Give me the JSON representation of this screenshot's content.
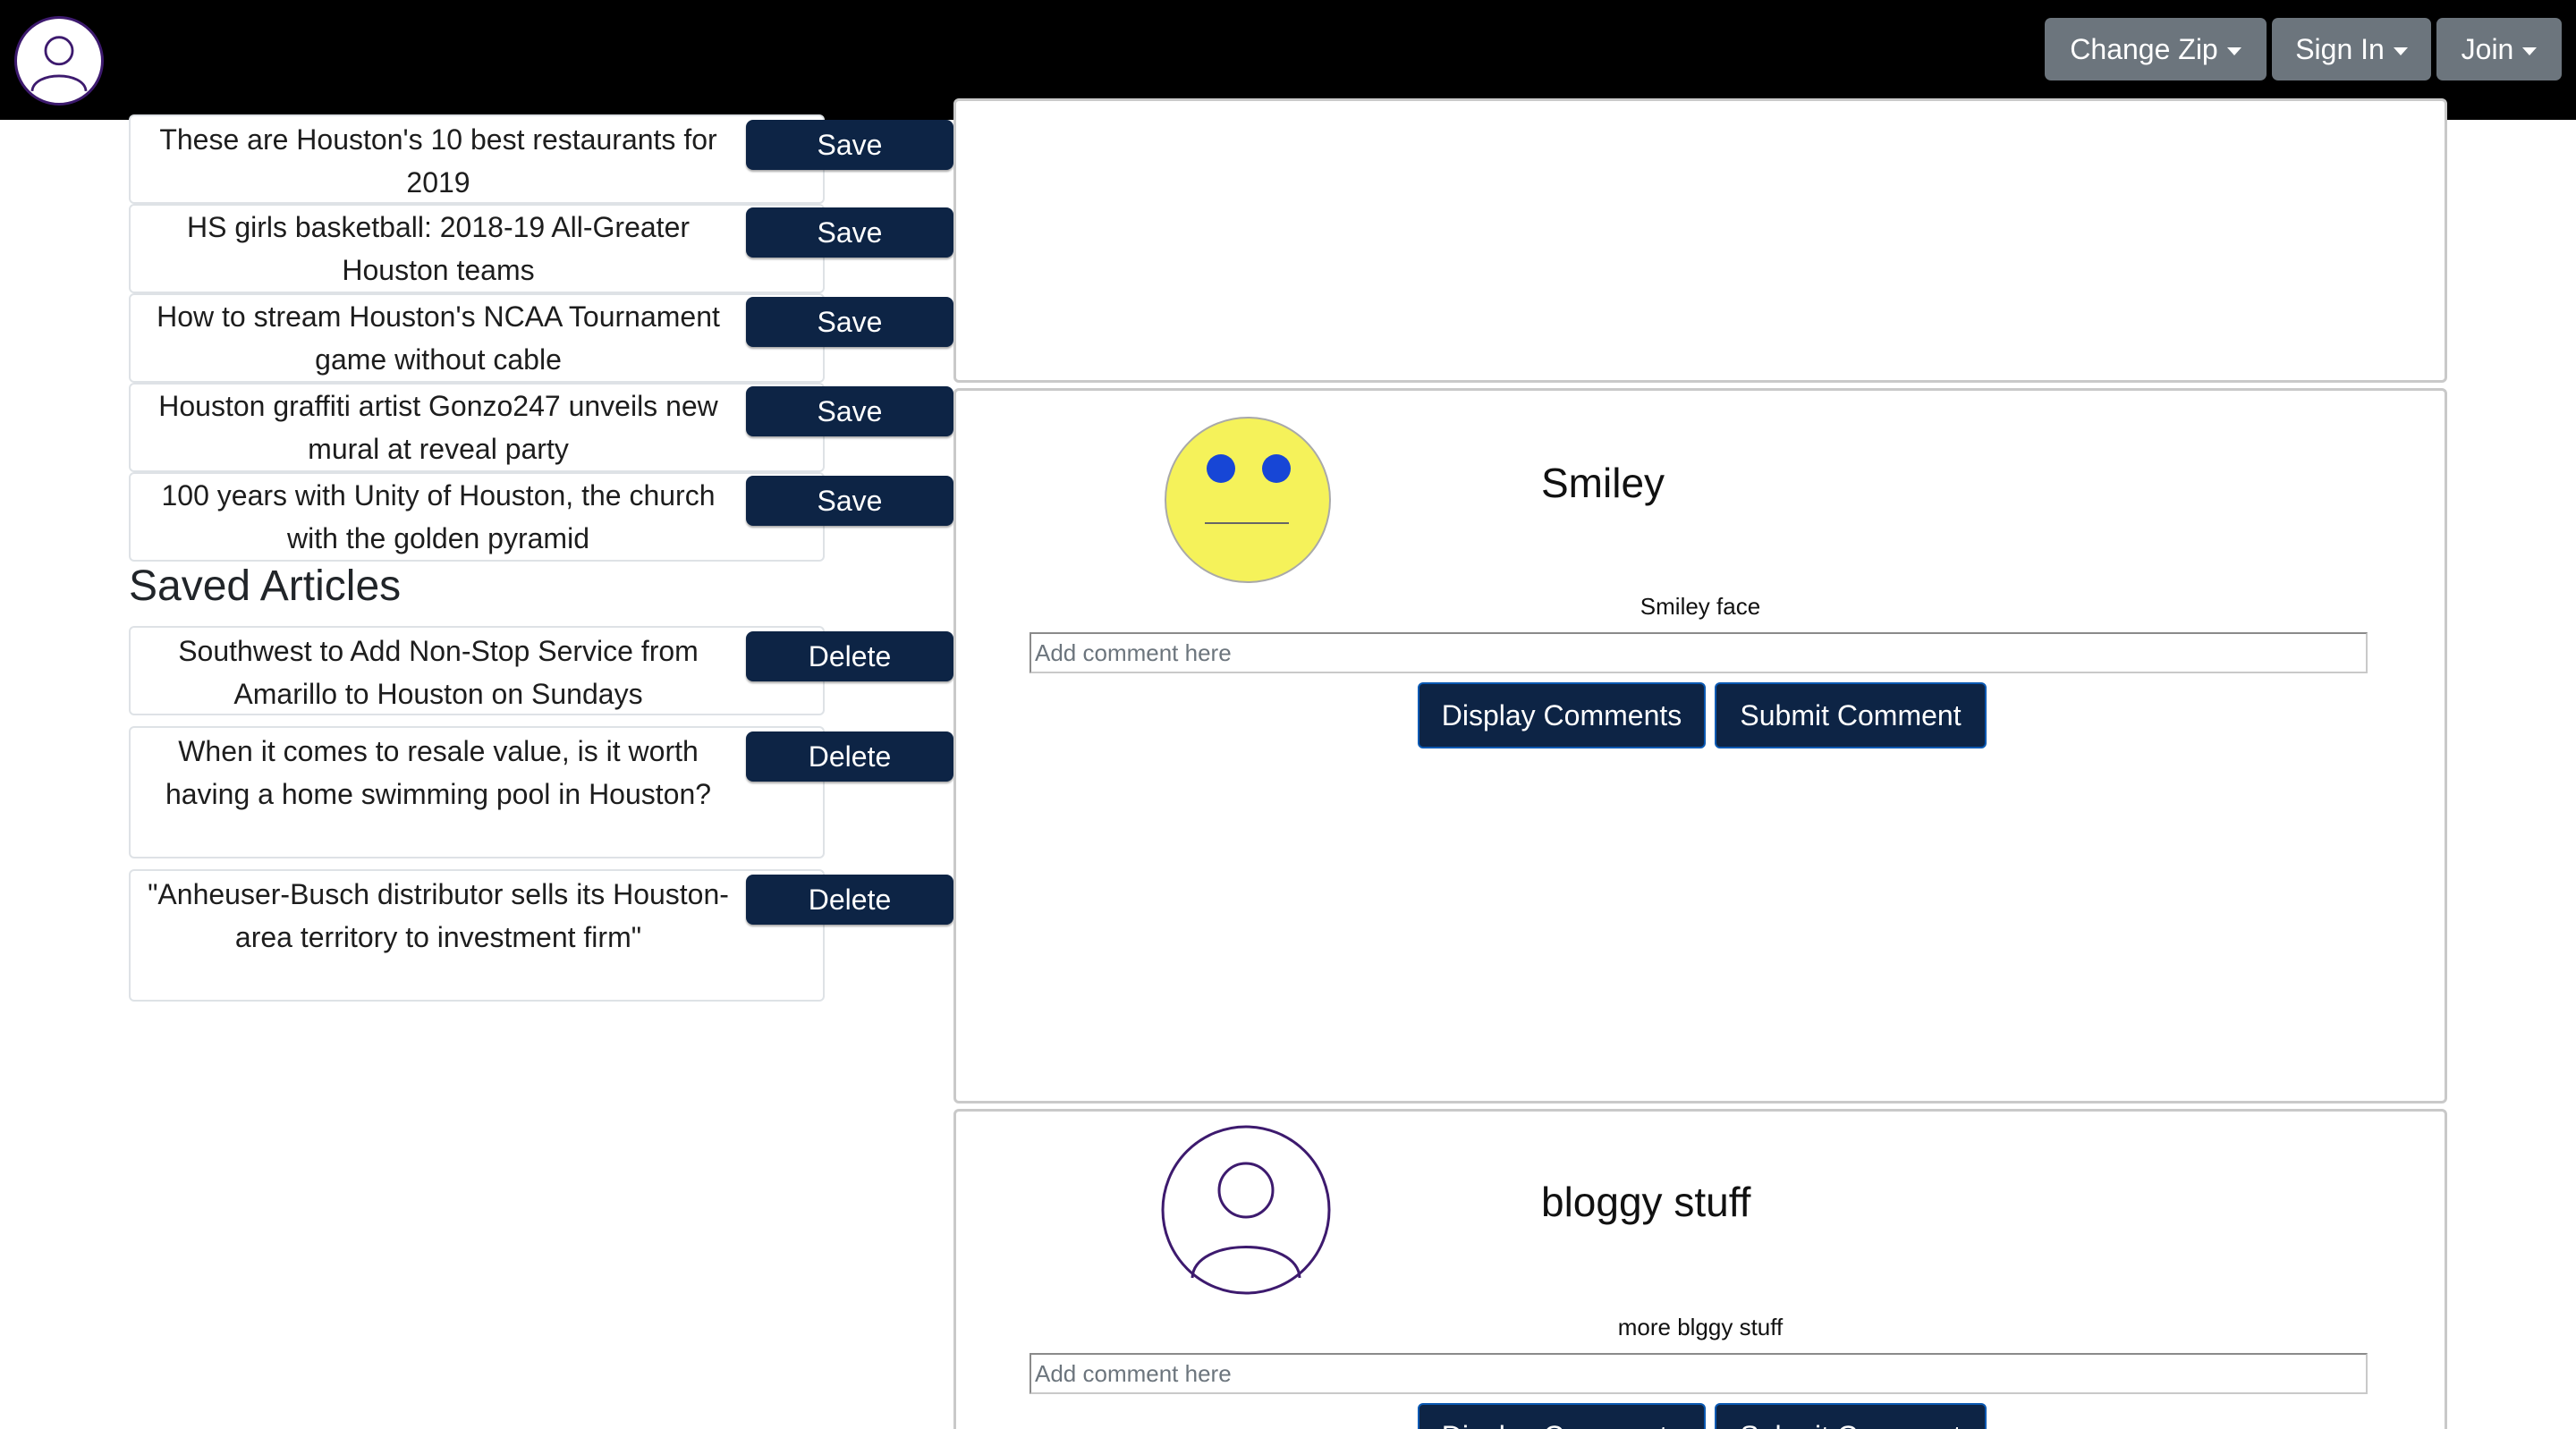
{
  "navbar": {
    "logo_icon": "user-avatar-icon",
    "change_zip_label": "Change Zip",
    "sign_in_label": "Sign In",
    "join_label": "Join"
  },
  "latest_articles": [
    {
      "title": "These are Houston's 10 best restaurants for 2019",
      "action": "Save"
    },
    {
      "title": "HS girls basketball: 2018-19 All-Greater Houston teams",
      "action": "Save"
    },
    {
      "title": "How to stream Houston's NCAA Tournament game without cable",
      "action": "Save"
    },
    {
      "title": "Houston graffiti artist Gonzo247 unveils new mural at reveal party",
      "action": "Save"
    },
    {
      "title": "100 years with Unity of Houston, the church with the golden pyramid",
      "action": "Save"
    }
  ],
  "saved_section": {
    "heading": "Saved Articles",
    "articles": [
      {
        "title": "Southwest to Add Non-Stop Service from Amarillo to Houston on Sundays",
        "action": "Delete"
      },
      {
        "title": "When it comes to resale value, is it worth having a home swimming pool in Houston?",
        "action": "Delete"
      },
      {
        "title": "\"Anheuser-Busch distributor sells its Houston-area territory to investment firm\"",
        "action": "Delete"
      }
    ]
  },
  "posts": [
    {
      "image_icon": "smiley-face-icon",
      "title": "Smiley",
      "text": "Smiley face",
      "comment_placeholder": "Add comment here",
      "display_comments_label": "Display Comments",
      "submit_comment_label": "Submit Comment"
    },
    {
      "image_icon": "user-avatar-icon",
      "title": "bloggy stuff",
      "text": "more blggy stuff",
      "comment_placeholder": "Add comment here",
      "display_comments_label": "Display Comments",
      "submit_comment_label": "Submit Comment"
    }
  ],
  "colors": {
    "navbar_bg": "#000000",
    "nav_button_bg": "#6c757d",
    "primary_button_bg": "#0d2445",
    "smiley_yellow": "#f5f25a",
    "smiley_eyes": "#1746d6",
    "avatar_stroke": "#3d1a6e"
  }
}
